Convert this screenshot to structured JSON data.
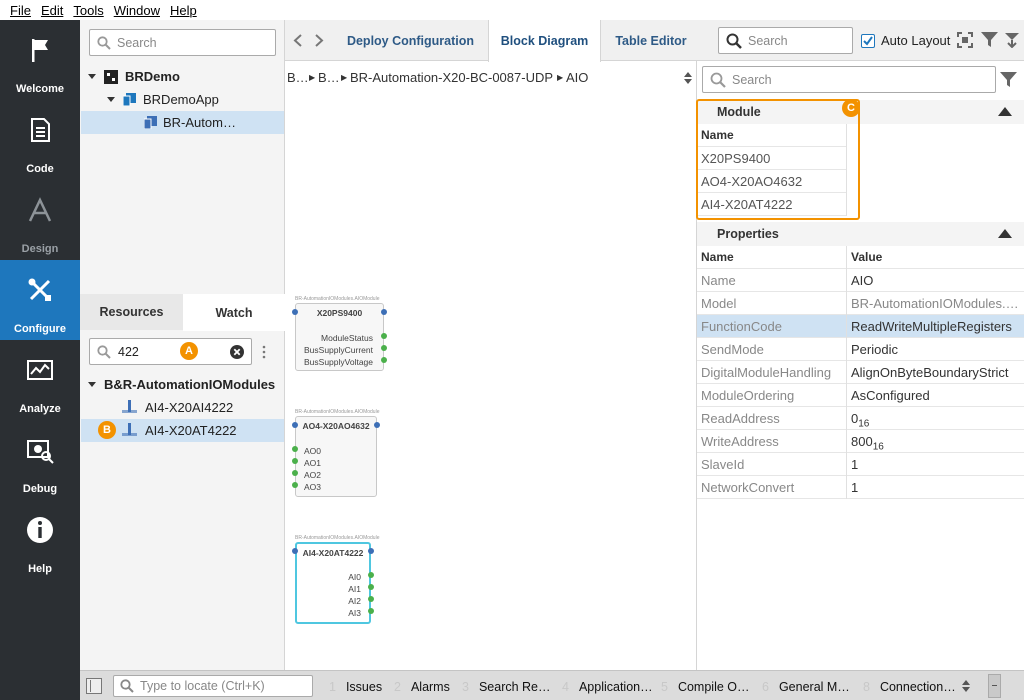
{
  "menu": [
    "File",
    "Edit",
    "Tools",
    "Window",
    "Help"
  ],
  "nav": [
    {
      "label": "Welcome",
      "icon": "flag-icon"
    },
    {
      "label": "Code",
      "icon": "document-icon"
    },
    {
      "label": "Design",
      "icon": "design-icon"
    },
    {
      "label": "Configure",
      "icon": "tools-icon"
    },
    {
      "label": "Analyze",
      "icon": "chart-icon"
    },
    {
      "label": "Debug",
      "icon": "debug-icon"
    },
    {
      "label": "Help",
      "icon": "info-icon"
    }
  ],
  "tree": {
    "search_placeholder": "Search",
    "items": [
      "BRDemo",
      "BRDemoApp",
      "BR-Autom…"
    ]
  },
  "resources": {
    "tabs": [
      "Resources",
      "Watch"
    ],
    "filter_value": "422",
    "group": "B&R-AutomationIOModules",
    "items": [
      "AI4-X20AI4222",
      "AI4-X20AT4222"
    ]
  },
  "center": {
    "tabs": [
      "Deploy Configuration",
      "Block Diagram",
      "Table Editor"
    ],
    "breadcrumb": [
      "B…",
      "B…",
      "BR-Automation-X20-BC-0087-UDP",
      "AIO"
    ],
    "blocks": [
      {
        "caption": "BR-AutomationIOModules.AIOModule",
        "title": "X20PS9400",
        "ports": [
          "ModuleStatus",
          "BusSupplyCurrent",
          "BusSupplyVoltage"
        ]
      },
      {
        "caption": "BR-AutomationIOModules.AIOModule",
        "title": "AO4-X20AO4632",
        "ports": [
          "AO0",
          "AO1",
          "AO2",
          "AO3"
        ]
      },
      {
        "caption": "BR-AutomationIOModules.AIOModule",
        "title": "AI4-X20AT4222",
        "ports": [
          "AI0",
          "AI1",
          "AI2",
          "AI3"
        ]
      }
    ]
  },
  "toolbar": {
    "search_placeholder": "Search",
    "auto_layout_label": "Auto Layout",
    "auto_layout_checked": true
  },
  "right": {
    "search_placeholder": "Search",
    "module_header": "Module",
    "module_col": "Name",
    "modules": [
      "X20PS9400",
      "AO4-X20AO4632",
      "AI4-X20AT4222"
    ],
    "properties_header": "Properties",
    "prop_cols": [
      "Name",
      "Value"
    ],
    "props": [
      {
        "name": "Name",
        "value": "AIO"
      },
      {
        "name": "Model",
        "value": "BR-AutomationIOModules.…"
      },
      {
        "name": "FunctionCode",
        "value": "ReadWriteMultipleRegisters"
      },
      {
        "name": "SendMode",
        "value": "Periodic"
      },
      {
        "name": "DigitalModuleHandling",
        "value": "AlignOnByteBoundaryStrict"
      },
      {
        "name": "ModuleOrdering",
        "value": "AsConfigured"
      },
      {
        "name": "ReadAddress",
        "value": "0",
        "sub": "16"
      },
      {
        "name": "WriteAddress",
        "value": "800",
        "sub": "16"
      },
      {
        "name": "SlaveId",
        "value": "1"
      },
      {
        "name": "NetworkConvert",
        "value": "1"
      }
    ]
  },
  "badges": [
    "A",
    "B",
    "C"
  ],
  "statusbar": {
    "locate_placeholder": "Type to locate (Ctrl+K)",
    "items": [
      {
        "num": "1",
        "label": "Issues"
      },
      {
        "num": "2",
        "label": "Alarms"
      },
      {
        "num": "3",
        "label": "Search Re…"
      },
      {
        "num": "4",
        "label": "Application…"
      },
      {
        "num": "5",
        "label": "Compile O…"
      },
      {
        "num": "6",
        "label": "General M…"
      },
      {
        "num": "8",
        "label": "Connection…"
      }
    ]
  },
  "colors": {
    "accent": "#1e77bd",
    "badge": "#f39200",
    "nav_bg": "#2b2f33",
    "selection": "#cfe2f3"
  }
}
